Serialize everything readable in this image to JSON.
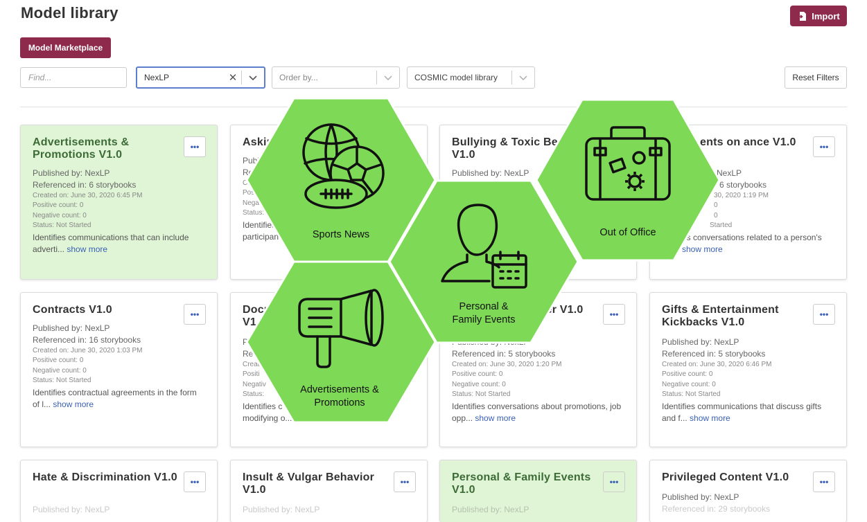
{
  "page": {
    "title": "Model library"
  },
  "toolbar": {
    "import_label": "Import",
    "marketplace_label": "Model Marketplace",
    "reset_label": "Reset Filters"
  },
  "filters": {
    "find_placeholder": "Find...",
    "publisher_value": "NexLP",
    "order_placeholder": "Order by...",
    "library_value": "COSMIC model library"
  },
  "cards": [
    {
      "title": "Advertisements & Promotions V1.0",
      "published": "Published by: NexLP",
      "referenced": "Referenced in: 6 storybooks",
      "created": "Created on: June 30, 2020 6:45 PM",
      "positive": "Positive count: 0",
      "negative": "Negative count: 0",
      "status": "Status: Not Started",
      "desc": "Identifies communications that can include adverti...",
      "show_more": "show more"
    },
    {
      "title": "Asking",
      "published": "Publi",
      "referenced": "Refe",
      "created": "Creat",
      "positive": "Posit",
      "negative": "Nega",
      "status": "Status:",
      "desc": "Identifies participan",
      "show_more": ""
    },
    {
      "title": "Bullying & Toxic Be V1.0",
      "published": "Published by: NexLP",
      "referenced": "",
      "created": "",
      "positive": "",
      "negative": "",
      "status": "",
      "desc": "",
      "show_more": ""
    },
    {
      "title": "ents on ance V1.0",
      "published": "NexLP",
      "referenced": "6 storybooks",
      "created": "30, 2020 1:19 PM",
      "positive": "0",
      "negative": "0",
      "status": "Started",
      "desc": "es conversations related to a person's",
      "show_more": "show more"
    },
    {
      "title": "Contracts V1.0",
      "published": "Published by: NexLP",
      "referenced": "Referenced in: 16 storybooks",
      "created": "Created on: June 30, 2020 1:03 PM",
      "positive": "Positive count: 0",
      "negative": "Negative count: 0",
      "status": "Status: Not Started",
      "desc": "Identifies contractual agreements in the form of l...",
      "show_more": "show more"
    },
    {
      "title": "Docu V1.0",
      "published": "Pu",
      "referenced": "Ref",
      "created": "Creat",
      "positive": "Positi",
      "negative": "Negativ",
      "status": "Status:",
      "desc": "Identifies c modifying o...",
      "show_more": ""
    },
    {
      "title": "areer V1.0",
      "published": "Published by: NexLP",
      "referenced": "Referenced in: 5 storybooks",
      "created": "Created on: June 30, 2020 1:20 PM",
      "positive": "Positive count: 0",
      "negative": "Negative count: 0",
      "status": "Status: Not Started",
      "desc": "Identifies conversations about promotions, job opp...",
      "show_more": "show more"
    },
    {
      "title": "Gifts & Entertainment Kickbacks V1.0",
      "published": "Published by: NexLP",
      "referenced": "Referenced in: 5 storybooks",
      "created": "Created on: June 30, 2020 6:46 PM",
      "positive": "Positive count: 0",
      "negative": "Negative count: 0",
      "status": "Status: Not Started",
      "desc": "Identifies communications that discuss gifts and f...",
      "show_more": "show more"
    },
    {
      "title": "Hate & Discrimination V1.0",
      "published": "Published by: NexLP"
    },
    {
      "title": "Insult & Vulgar Behavior V1.0",
      "published": "Published by: NexLP"
    },
    {
      "title": "Personal & Family Events V1.0",
      "published": "Published by: NexLP"
    },
    {
      "title": "Privileged Content V1.0",
      "published": "Published by: NexLP",
      "referenced": "Referenced in: 29 storybooks"
    }
  ],
  "hexagons": [
    {
      "label": "Sports News",
      "icon": "sports-balls-icon"
    },
    {
      "label": "Out of Office",
      "icon": "suitcase-icon"
    },
    {
      "label": "Personal & Family Events",
      "icon": "person-calendar-icon"
    },
    {
      "label": "Advertisements & Promotions",
      "icon": "megaphone-icon"
    }
  ],
  "colors": {
    "brand": "#8e2b4c",
    "hex_green": "#7ed957",
    "card_green": "#dff5d5",
    "link": "#3a5fb5"
  }
}
